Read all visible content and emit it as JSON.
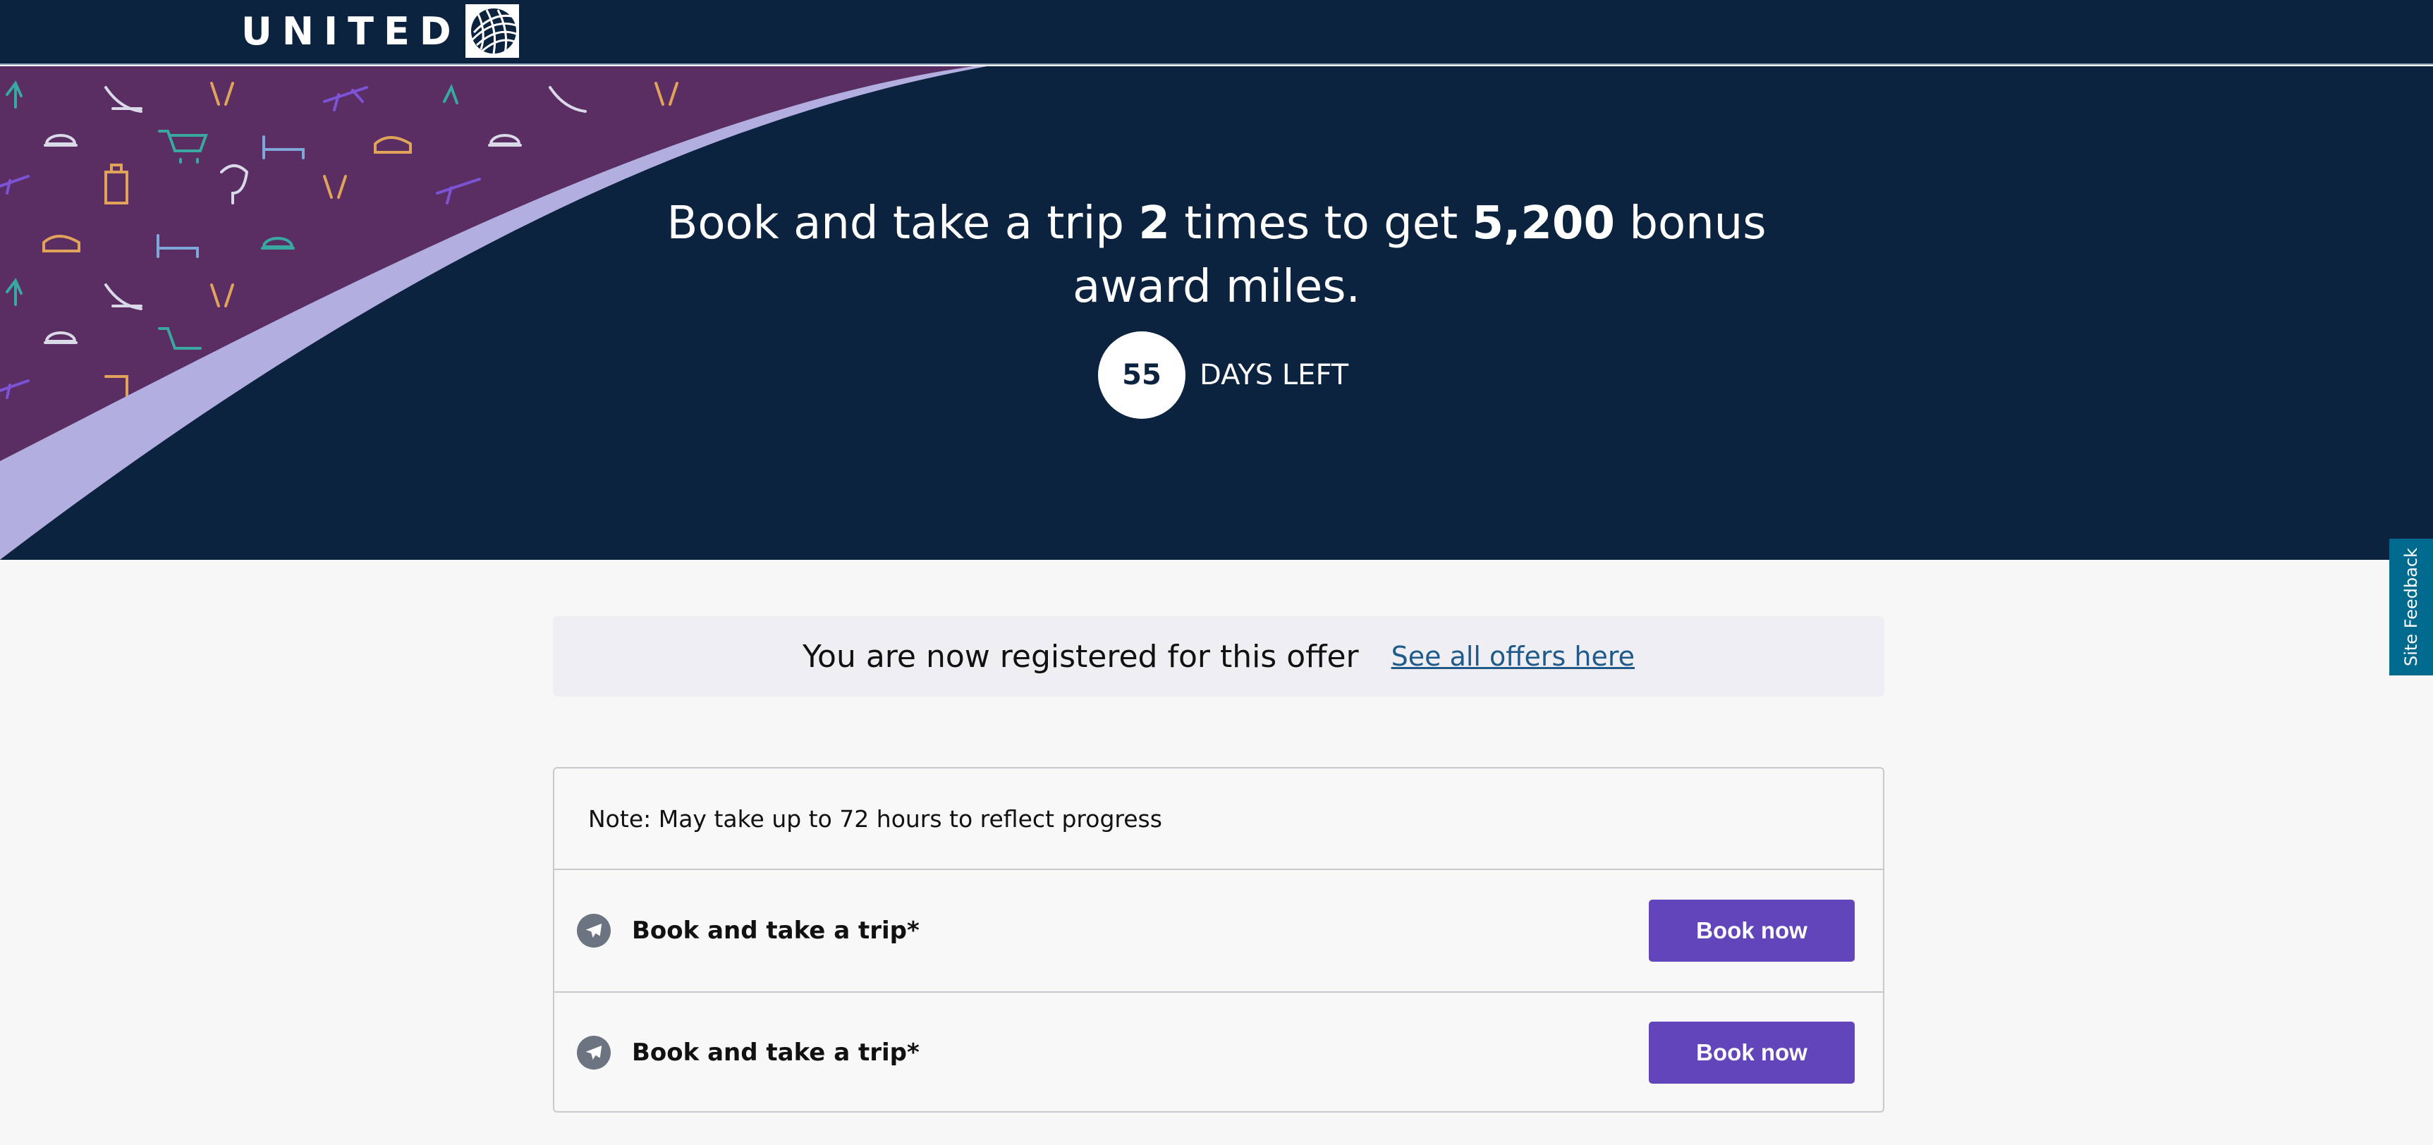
{
  "header": {
    "logo_text": "UNITED"
  },
  "hero": {
    "headline_part1": "Book and take a trip ",
    "headline_count": "2",
    "headline_part2": " times to get ",
    "headline_miles": "5,200",
    "headline_part3": " bonus award miles.",
    "days_left": "55",
    "days_left_label": "DAYS LEFT",
    "background_color": "#0c2340",
    "pattern_color": "#5a2e63",
    "swoosh_color": "#b3aee0"
  },
  "registration": {
    "message": "You are now registered for this offer",
    "link_label": "See all offers here"
  },
  "progress": {
    "note": "Note: May take up to 72 hours to reflect progress",
    "tasks": [
      {
        "label": "Book and take a trip*",
        "button": "Book now",
        "icon": "airplane-icon"
      },
      {
        "label": "Book and take a trip*",
        "button": "Book now",
        "icon": "airplane-icon"
      }
    ],
    "button_color": "#6244bb"
  },
  "feedback": {
    "label": "Site Feedback"
  }
}
